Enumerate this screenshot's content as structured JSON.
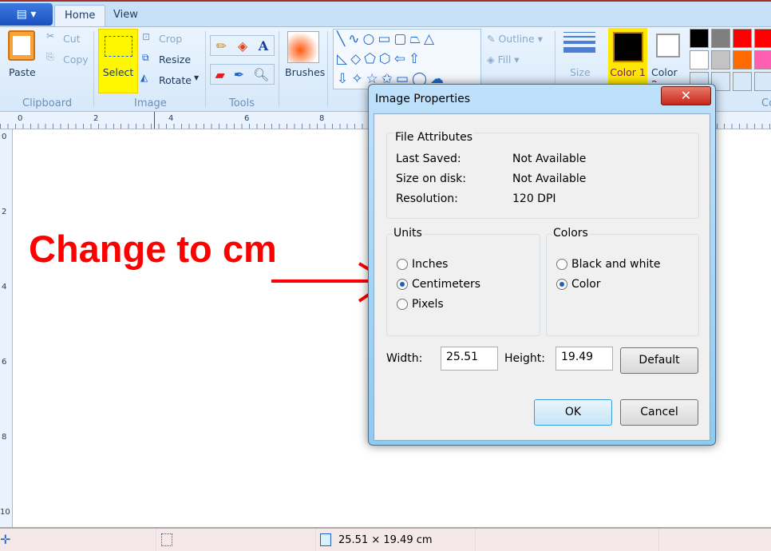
{
  "tabs": [
    {
      "label": "Home"
    },
    {
      "label": "View"
    }
  ],
  "ribbon": {
    "clipboard": {
      "label": "Clipboard",
      "paste": "Paste",
      "cut": "Cut",
      "copy": "Copy"
    },
    "image": {
      "label": "Image",
      "select": "Select",
      "crop": "Crop",
      "resize": "Resize",
      "rotate": "Rotate"
    },
    "tools": {
      "label": "Tools"
    },
    "brushes": "Brushes",
    "shapes": {
      "outline": "Outline",
      "fill": "Fill"
    },
    "size": "Size",
    "color1": "Color 1",
    "color2": "Color 2",
    "colors_label": "Co",
    "palette": [
      "#000000",
      "#7f7f7f",
      "#ff0000",
      "#ff0000",
      "#ffffff",
      "#c3c3c3",
      "#ff6a00",
      "#ff5fb0"
    ]
  },
  "ruler": {
    "top": [
      "0",
      "2",
      "4",
      "6",
      "8"
    ],
    "left": [
      "0",
      "2",
      "4",
      "6",
      "8",
      "10"
    ]
  },
  "annotation": "Change to cm",
  "dialog": {
    "title": "Image Properties",
    "file_attributes": {
      "title": "File Attributes",
      "rows": [
        {
          "label": "Last Saved:",
          "value": "Not Available"
        },
        {
          "label": "Size on disk:",
          "value": "Not Available"
        },
        {
          "label": "Resolution:",
          "value": "120 DPI"
        }
      ]
    },
    "units": {
      "title": "Units",
      "options": [
        "Inches",
        "Centimeters",
        "Pixels"
      ],
      "selected": "Centimeters"
    },
    "colors": {
      "title": "Colors",
      "options": [
        "Black and white",
        "Color"
      ],
      "selected": "Color"
    },
    "width_label": "Width:",
    "width_value": "25.51",
    "height_label": "Height:",
    "height_value": "19.49",
    "default": "Default",
    "ok": "OK",
    "cancel": "Cancel"
  },
  "status": {
    "canvas_size": "25.51 × 19.49 cm"
  }
}
